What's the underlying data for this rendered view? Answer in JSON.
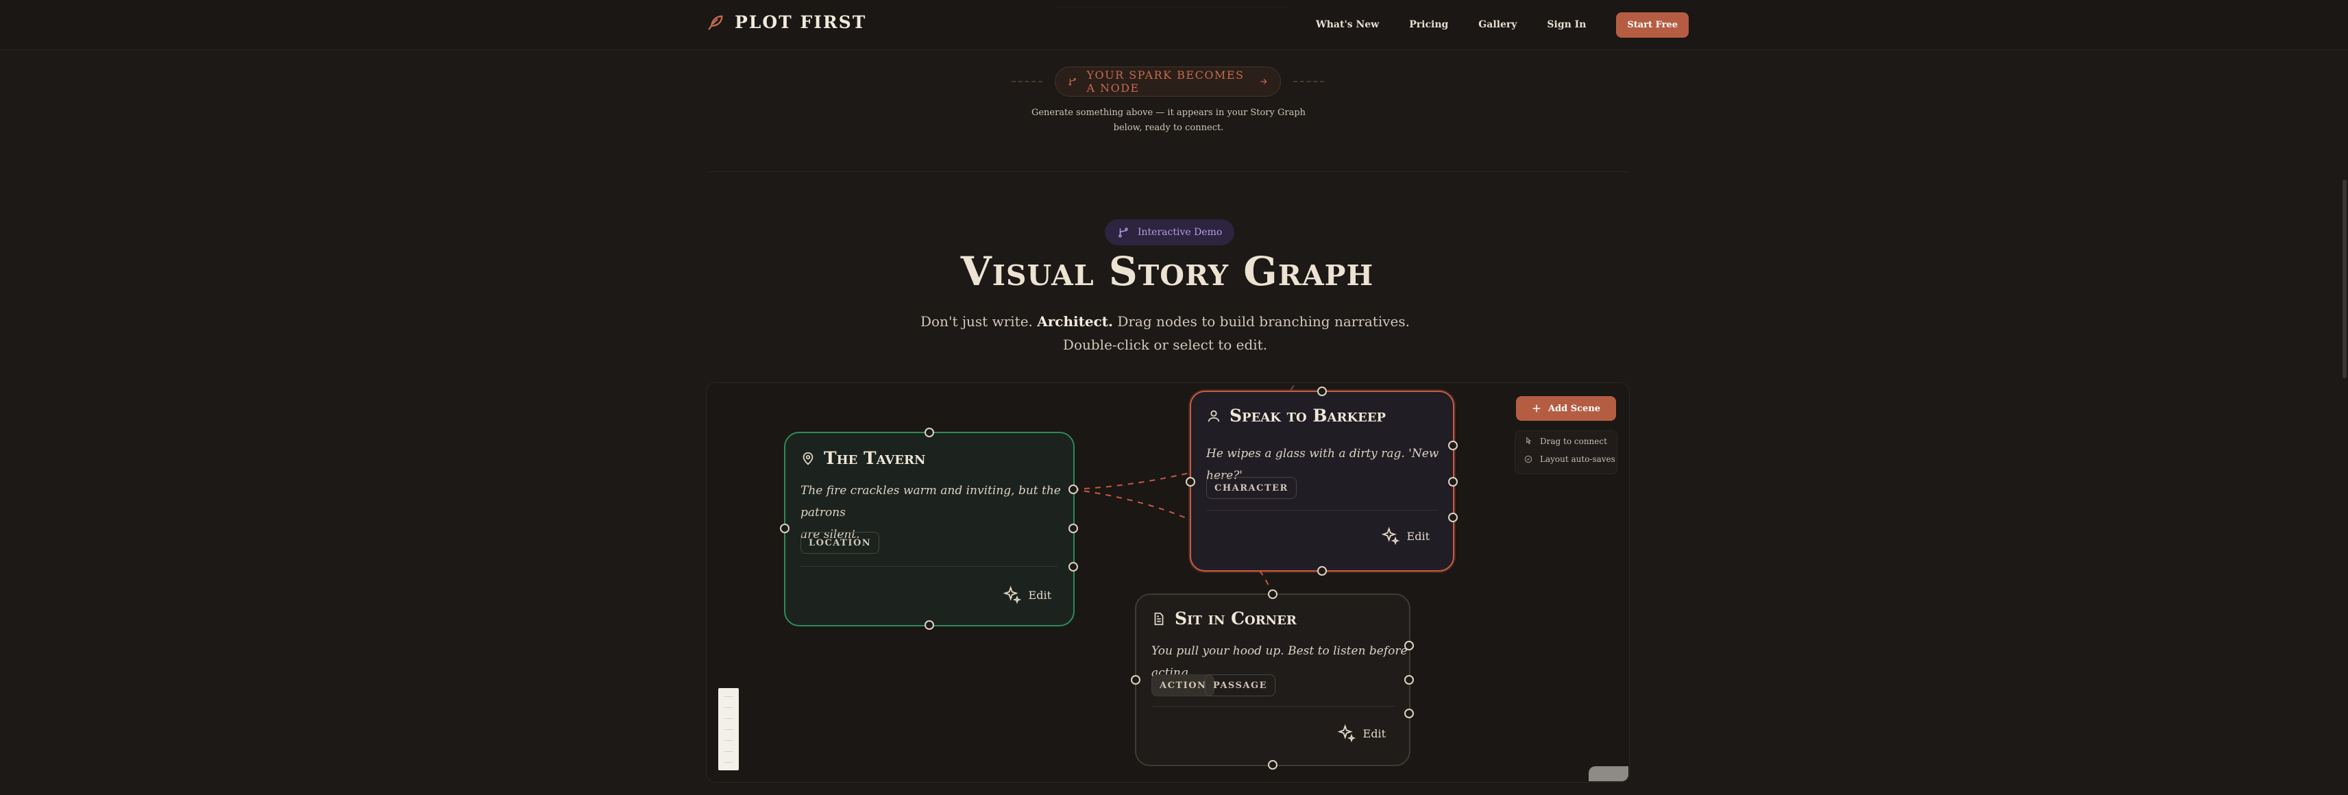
{
  "header": {
    "brand": "PLOT FIRST",
    "nav": [
      "What's New",
      "Pricing",
      "Gallery",
      "Sign In"
    ],
    "cta": "Start Free"
  },
  "spark": {
    "pill": "YOUR SPARK BECOMES A NODE",
    "desc_line1": "Generate something above — it appears in your Story Graph",
    "desc_line2": "below, ready to connect."
  },
  "demo": {
    "badge": "Interactive Demo",
    "title": "Visual Story Graph",
    "subtitle_pre": "Don't just write.",
    "subtitle_bold": "Architect.",
    "subtitle_post": "Drag nodes to build branching narratives. Double-click or select to edit."
  },
  "nodes": {
    "tavern": {
      "title": "The Tavern",
      "text1": "The fire crackles warm and inviting, but the patrons",
      "text2": "are silent.",
      "tag": "LOCATION",
      "edit": "Edit"
    },
    "barkeep": {
      "title": "Speak to Barkeep",
      "text": "He wipes a glass with a dirty rag. 'New here?'",
      "tag": "CHARACTER",
      "edit": "Edit"
    },
    "corner": {
      "title": "Sit in Corner",
      "text": "You pull your hood up. Best to listen before acting.",
      "tags": [
        "ACTION",
        "PASSAGE"
      ],
      "edit": "Edit"
    }
  },
  "toolbar": {
    "add_scene": "Add Scene",
    "hints": [
      "Drag to connect",
      "Layout auto-saves"
    ]
  },
  "colors": {
    "accent": "#b55d43",
    "location": "#2e8b5a",
    "selected": "#c75c42",
    "badge": "#b59be0"
  }
}
